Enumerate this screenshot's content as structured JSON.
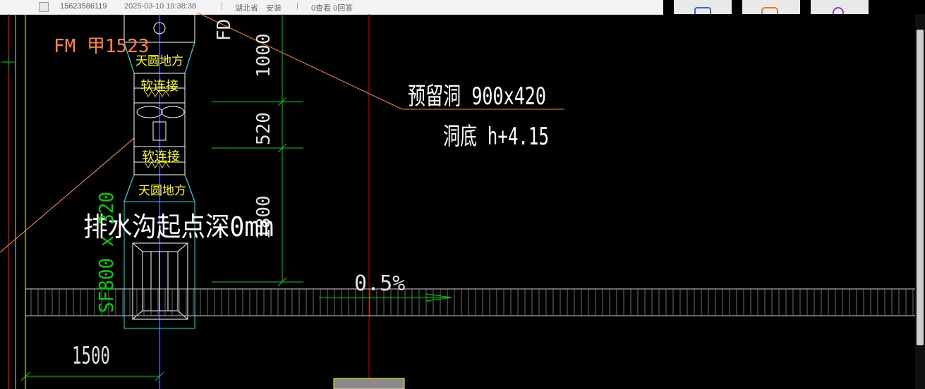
{
  "header": {
    "phone": "15623586119",
    "datetime": "2025-03-10 19:38:38",
    "separator": "|",
    "region": "湖北省",
    "category": "安装",
    "stats": "0查看  0回答"
  },
  "drawing": {
    "fire_damper_label": "FM 甲1523",
    "fd_label": "FD",
    "transition_top": "天圆地方",
    "transition_bottom": "天圆地方",
    "flex_joint_top": "软连接",
    "flex_joint_bottom": "软连接",
    "dim_1000": "1000",
    "dim_520": "520",
    "dim_1800": "1800",
    "reserved_hole": "预留洞 900x420",
    "hole_bottom": "洞底 h+4.15",
    "trench_start": "排水沟起点深0mm",
    "sf_label": "SF800 x 320",
    "slope": "0.5%",
    "dim_1500": "1500"
  },
  "colors": {
    "background": "#000000",
    "white": "#ffffff",
    "yellow": "#ffff00",
    "green": "#00d000",
    "cyan": "#00e6e6",
    "red": "#e00000",
    "orange": "#ff8040",
    "blue": "#3b5bff"
  }
}
